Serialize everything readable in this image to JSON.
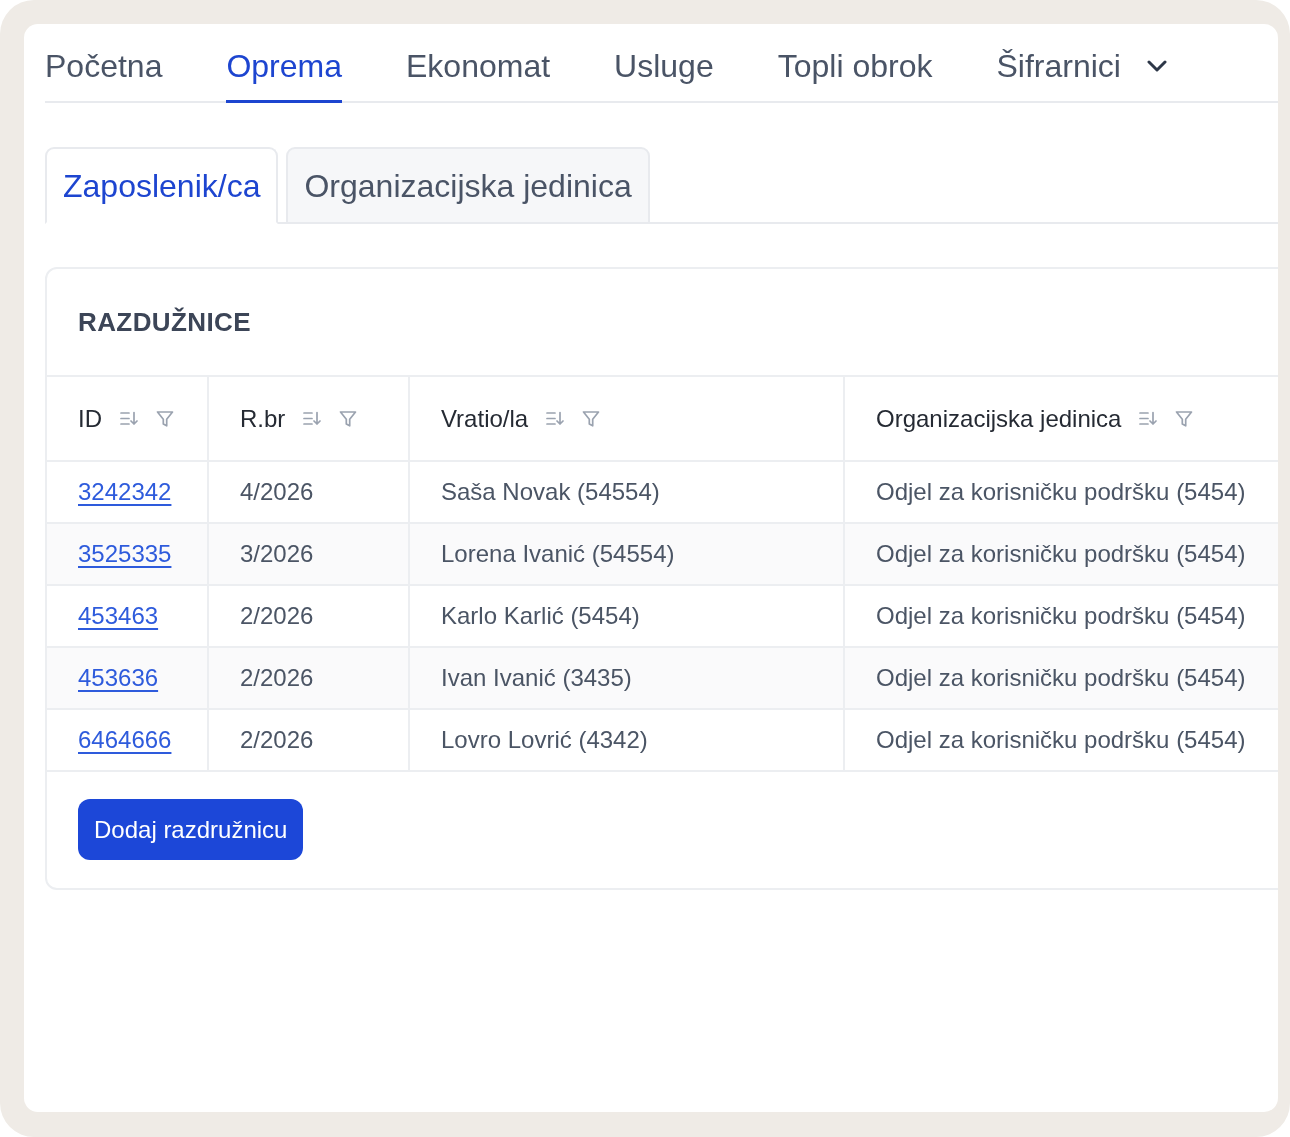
{
  "top_nav": {
    "items": [
      {
        "label": "Početna",
        "kind": "link",
        "selected": false
      },
      {
        "label": "Oprema",
        "kind": "link",
        "selected": true
      },
      {
        "label": "Ekonomat",
        "kind": "link",
        "selected": false
      },
      {
        "label": "Usluge",
        "kind": "link",
        "selected": false
      },
      {
        "label": "Topli obrok",
        "kind": "link",
        "selected": false
      },
      {
        "label": "Šifrarnici",
        "kind": "dropdown",
        "selected": false
      }
    ]
  },
  "sub_tabs": [
    {
      "label": "Zaposlenik/ca",
      "selected": true
    },
    {
      "label": "Organizacijska jedinica",
      "selected": false
    }
  ],
  "card": {
    "title": "RAZDUŽNICE",
    "table": {
      "columns": [
        "ID",
        "R.br",
        "Vratio/la",
        "Organizacijska jedinica"
      ],
      "rows": [
        [
          "3242342",
          "4/2026",
          "Saša Novak (54554)",
          "Odjel za korisničku podršku (5454)"
        ],
        [
          "3525335",
          "3/2026",
          "Lorena Ivanić (54554)",
          "Odjel za korisničku podršku (5454)"
        ],
        [
          "453463",
          "2/2026",
          "Karlo Karlić (5454)",
          "Odjel za korisničku podršku (5454)"
        ],
        [
          "453636",
          "2/2026",
          "Ivan Ivanić (3435)",
          "Odjel za korisničku podršku (5454)"
        ],
        [
          "6464666",
          "2/2026",
          "Lovro Lovrić (4342)",
          "Odjel za korisničku podršku (5454)"
        ]
      ]
    },
    "add_button": "Dodaj razdružnicu"
  }
}
